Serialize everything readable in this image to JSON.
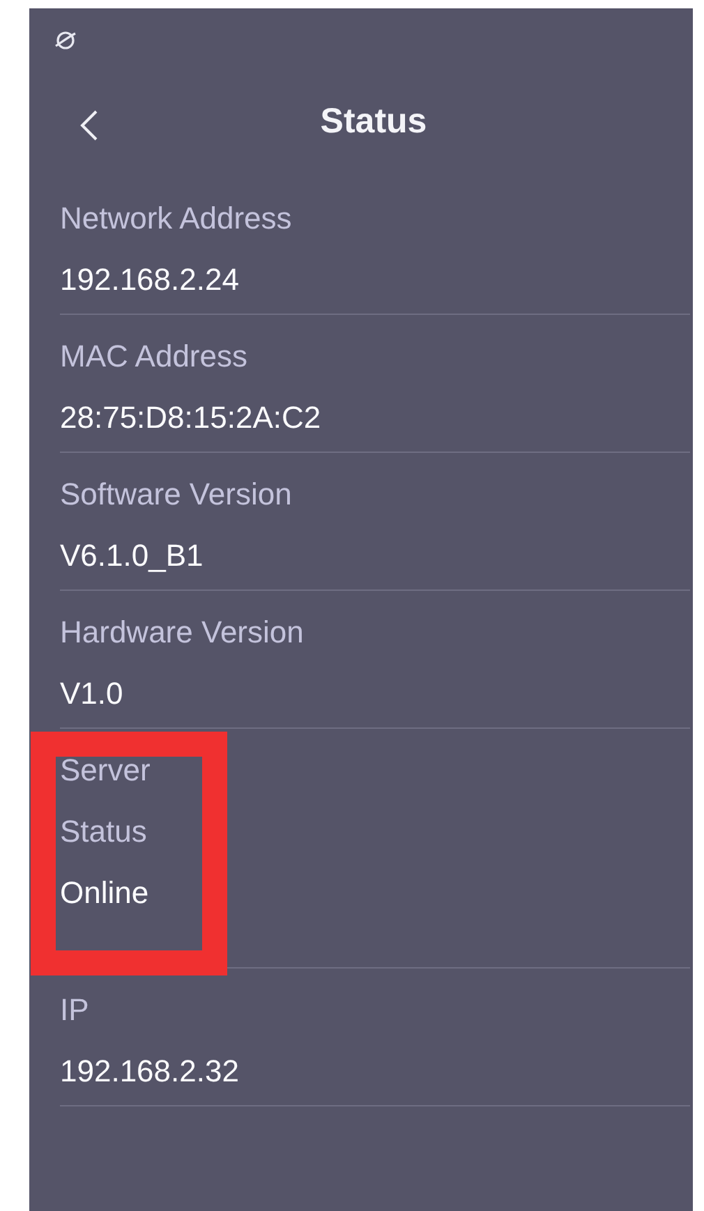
{
  "header": {
    "title": "Status"
  },
  "items": [
    {
      "label": "Network Address",
      "value": "192.168.2.24",
      "highlighted": false
    },
    {
      "label": "MAC Address",
      "value": "28:75:D8:15:2A:C2",
      "highlighted": false
    },
    {
      "label": "Software Version",
      "value": "V6.1.0_B1",
      "highlighted": false
    },
    {
      "label": "Hardware Version",
      "value": "V1.0",
      "highlighted": false
    },
    {
      "label": "Server Status",
      "value": "Online",
      "highlighted": true
    },
    {
      "label": "IP",
      "value": "192.168.2.32",
      "highlighted": false
    }
  ]
}
